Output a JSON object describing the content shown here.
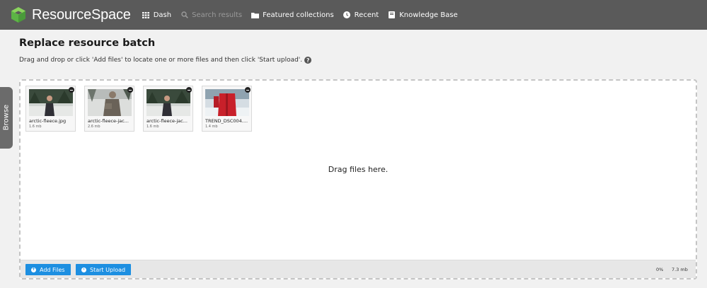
{
  "header": {
    "logo_text": "ResourceSpace",
    "nav": [
      {
        "label": "Dash",
        "icon": "grid-icon",
        "enabled": true
      },
      {
        "label": "Search results",
        "icon": "search-icon",
        "enabled": false
      },
      {
        "label": "Featured collections",
        "icon": "folder-icon",
        "enabled": true
      },
      {
        "label": "Recent",
        "icon": "clock-icon",
        "enabled": true
      },
      {
        "label": "Knowledge Base",
        "icon": "book-icon",
        "enabled": true
      }
    ]
  },
  "page": {
    "title": "Replace resource batch",
    "instructions": "Drag and drop or click 'Add files' to locate one or more files and then click 'Start upload'.",
    "help_icon": "?"
  },
  "sidebar": {
    "browse_label": "Browse"
  },
  "uploader": {
    "files": [
      {
        "name": "arctic-fleece.jpg",
        "size": "1.6 mb"
      },
      {
        "name": "arctic-fleece-jac...",
        "size": "2.6 mb"
      },
      {
        "name": "arctic-fleece-jac...",
        "size": "1.6 mb"
      },
      {
        "name": "TREND_DSC004....",
        "size": "1.4 mb"
      }
    ],
    "drop_text": "Drag files here.",
    "add_files_label": "Add Files",
    "start_upload_label": "Start Upload",
    "progress": "0%",
    "total_size": "7.3 mb"
  },
  "colors": {
    "topbar": "#5a5a5a",
    "button": "#1d8fe1",
    "logo_green": "#6cc24a"
  }
}
